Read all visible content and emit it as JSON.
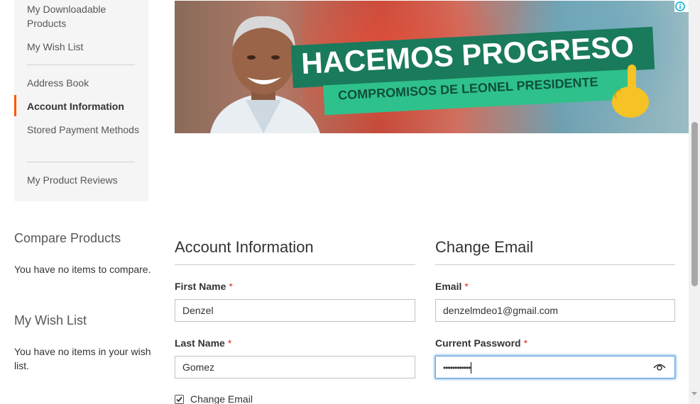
{
  "sidebar": {
    "items": [
      {
        "label": "My Downloadable Products"
      },
      {
        "label": "My Wish List"
      },
      {
        "label": "Address Book"
      },
      {
        "label": "Account Information",
        "active": true
      },
      {
        "label": "Stored Payment Methods"
      },
      {
        "label": "My Product Reviews"
      }
    ],
    "active_color": "#ff5501"
  },
  "compare": {
    "title": "Compare Products",
    "empty_text": "You have no items to compare."
  },
  "wishlist_block": {
    "title": "My Wish List",
    "empty_text": "You have no items in your wish list."
  },
  "ad": {
    "headline": "HACEMOS PROGRESO",
    "subline": "COMPROMISOS DE LEONEL PRESIDENTE",
    "info_icon": "info-icon",
    "close_icon": "close-icon"
  },
  "account_info": {
    "title": "Account Information",
    "first_name_label": "First Name",
    "first_name_value": "Denzel",
    "last_name_label": "Last Name",
    "last_name_value": "Gomez",
    "change_email_label": "Change Email",
    "change_email_checked": true,
    "required_mark": "*"
  },
  "change_email": {
    "title": "Change Email",
    "email_label": "Email",
    "email_value": "denzelmdeo1@gmail.com",
    "password_label": "Current Password",
    "password_value": "••••••••••••",
    "required_mark": "*",
    "show_password_icon": "eye-icon"
  }
}
